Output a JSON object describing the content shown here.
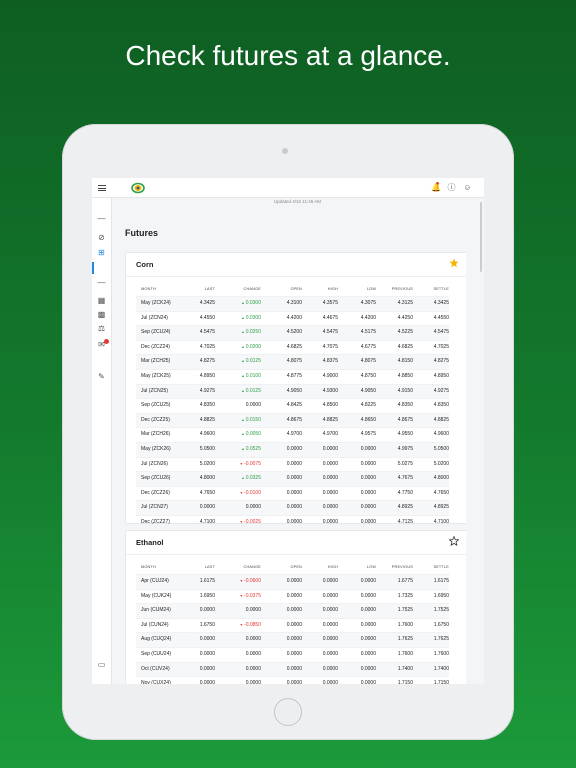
{
  "headline": "Check futures at a glance.",
  "updated": "Updated 4/10 11:46 AM",
  "page_title": "Futures",
  "columns": [
    "MONTH",
    "LAST",
    "CHANGE",
    "OPEN",
    "HIGH",
    "LOW",
    "PREVIOUS",
    "SETTLE"
  ],
  "colors": {
    "up": "#2e9e48",
    "down": "#e53935",
    "favorite": "#f5b400",
    "accent": "#1e88e5"
  },
  "corn": {
    "title": "Corn",
    "favorite": true,
    "rows": [
      [
        "May (ZCK24)",
        "4.3425",
        "0.0300",
        "4.3100",
        "4.3575",
        "4.3075",
        "4.3125",
        "4.3425",
        "up"
      ],
      [
        "Jul (ZCN24)",
        "4.4550",
        "0.0300",
        "4.4200",
        "4.4675",
        "4.4200",
        "4.4250",
        "4.4550",
        "up"
      ],
      [
        "Sep (ZCU24)",
        "4.5475",
        "0.0250",
        "4.5200",
        "4.5475",
        "4.5175",
        "4.5225",
        "4.5475",
        "up"
      ],
      [
        "Dec (ZCZ24)",
        "4.7025",
        "0.0200",
        "4.6825",
        "4.7075",
        "4.6775",
        "4.6825",
        "4.7025",
        "up"
      ],
      [
        "Mar (ZCH25)",
        "4.8275",
        "0.0125",
        "4.8075",
        "4.8375",
        "4.8075",
        "4.8150",
        "4.8275",
        "up"
      ],
      [
        "May (ZCK25)",
        "4.8950",
        "0.0100",
        "4.8775",
        "4.9000",
        "4.8750",
        "4.8850",
        "4.8950",
        "up"
      ],
      [
        "Jul (ZCN25)",
        "4.9275",
        "0.0125",
        "4.9050",
        "4.9300",
        "4.9050",
        "4.9150",
        "4.9275",
        "up"
      ],
      [
        "Sep (ZCU25)",
        "4.8350",
        "0.0000",
        "4.8425",
        "4.8500",
        "4.8225",
        "4.8350",
        "4.8350",
        "none"
      ],
      [
        "Dec (ZCZ25)",
        "4.8825",
        "0.0150",
        "4.8675",
        "4.8825",
        "4.8650",
        "4.8675",
        "4.8825",
        "up"
      ],
      [
        "Mar (ZCH26)",
        "4.9600",
        "0.0050",
        "4.9700",
        "4.9700",
        "4.9575",
        "4.9550",
        "4.9600",
        "up"
      ],
      [
        "May (ZCK26)",
        "5.0500",
        "0.0525",
        "0.0000",
        "0.0000",
        "0.0000",
        "4.9975",
        "5.0500",
        "up"
      ],
      [
        "Jul (ZCN26)",
        "5.0200",
        "-0.0075",
        "0.0000",
        "0.0000",
        "0.0000",
        "5.0275",
        "5.0200",
        "down"
      ],
      [
        "Sep (ZCU26)",
        "4.8000",
        "0.0325",
        "0.0000",
        "0.0000",
        "0.0000",
        "4.7675",
        "4.8000",
        "up"
      ],
      [
        "Dec (ZCZ26)",
        "4.7650",
        "-0.0100",
        "0.0000",
        "0.0000",
        "0.0000",
        "4.7750",
        "4.7650",
        "down"
      ],
      [
        "Jul (ZCN27)",
        "0.0000",
        "0.0000",
        "0.0000",
        "0.0000",
        "0.0000",
        "4.8925",
        "4.8925",
        "none"
      ],
      [
        "Dec (ZCZ27)",
        "4.7100",
        "-0.0025",
        "0.0000",
        "0.0000",
        "0.0000",
        "4.7125",
        "4.7100",
        "down"
      ]
    ]
  },
  "ethanol": {
    "title": "Ethanol",
    "favorite": false,
    "rows": [
      [
        "Apr (CUJ24)",
        "1.6175",
        "-0.0600",
        "0.0000",
        "0.0000",
        "0.0000",
        "1.6775",
        "1.6175",
        "down"
      ],
      [
        "May (CUK24)",
        "1.6950",
        "-0.0375",
        "0.0000",
        "0.0000",
        "0.0000",
        "1.7325",
        "1.6950",
        "down"
      ],
      [
        "Jun (CUM24)",
        "0.0000",
        "0.0000",
        "0.0000",
        "0.0000",
        "0.0000",
        "1.7525",
        "1.7525",
        "none"
      ],
      [
        "Jul (CUN24)",
        "1.6750",
        "-0.0850",
        "0.0000",
        "0.0000",
        "0.0000",
        "1.7600",
        "1.6750",
        "down"
      ],
      [
        "Aug (CUQ24)",
        "0.0000",
        "0.0000",
        "0.0000",
        "0.0000",
        "0.0000",
        "1.7625",
        "1.7625",
        "none"
      ],
      [
        "Sep (CUU24)",
        "0.0000",
        "0.0000",
        "0.0000",
        "0.0000",
        "0.0000",
        "1.7600",
        "1.7600",
        "none"
      ],
      [
        "Oct (CUV24)",
        "0.0000",
        "0.0000",
        "0.0000",
        "0.0000",
        "0.0000",
        "1.7400",
        "1.7400",
        "none"
      ],
      [
        "Nov (CUX24)",
        "0.0000",
        "0.0000",
        "0.0000",
        "0.0000",
        "0.0000",
        "1.7150",
        "1.7150",
        "none"
      ]
    ]
  }
}
